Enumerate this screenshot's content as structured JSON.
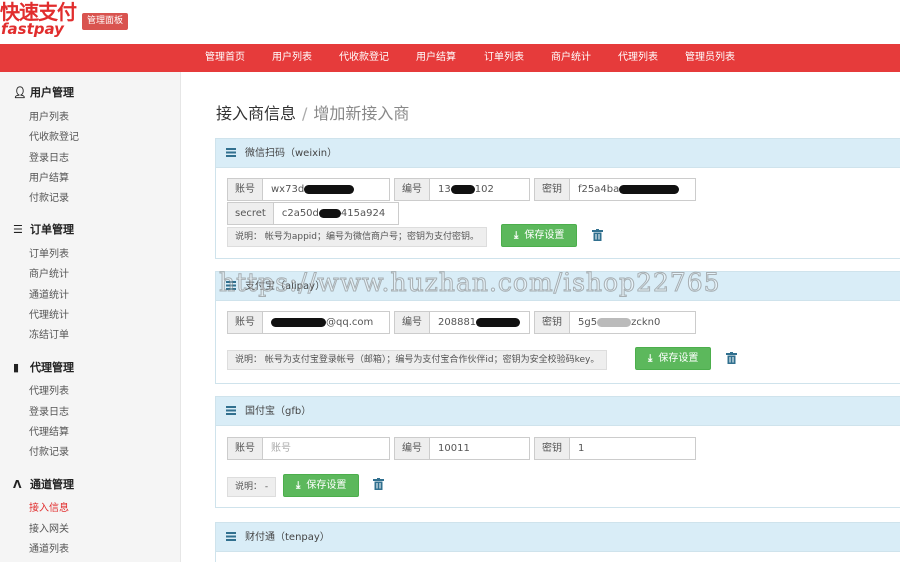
{
  "brand": {
    "name_cn": "快速支付",
    "name_en": "fastpay",
    "badge": "管理面板"
  },
  "topnav": [
    "管理首页",
    "用户列表",
    "代收款登记",
    "用户结算",
    "订单列表",
    "商户统计",
    "代理列表",
    "管理员列表"
  ],
  "sidebar": {
    "groups": [
      {
        "title": "用户管理",
        "icon": "user-icon",
        "items": [
          "用户列表",
          "代收款登记",
          "登录日志",
          "用户结算",
          "付款记录"
        ]
      },
      {
        "title": "订单管理",
        "icon": "list-icon",
        "items": [
          "订单列表",
          "商户统计",
          "通道统计",
          "代理统计",
          "冻结订单"
        ]
      },
      {
        "title": "代理管理",
        "icon": "file-icon",
        "items": [
          "代理列表",
          "登录日志",
          "代理结算",
          "付款记录"
        ]
      },
      {
        "title": "通道管理",
        "icon": "road-icon",
        "items": [
          "接入信息",
          "接入网关",
          "通道列表"
        ]
      }
    ],
    "active_item": "接入信息"
  },
  "breadcrumb": {
    "title": "接入商信息",
    "separator": "/",
    "subtitle": "增加新接入商"
  },
  "panels": {
    "weixin": {
      "title": "微信扫码（weixin）",
      "account_label": "账号",
      "account_value": "wx73d",
      "id_label": "编号",
      "id_value_a": "13",
      "id_value_b": "102",
      "key_label": "密钥",
      "key_value": "f25a4ba",
      "secret_label": "secret",
      "secret_value_a": "c2a50d",
      "secret_value_b": "415a924",
      "note": "说明：  帐号为appid；编号为微信商户号；密钥为支付密钥。",
      "save": "保存设置"
    },
    "alipay": {
      "title": "支付宝（alipay）",
      "account_label": "账号",
      "account_value": "@qq.com",
      "id_label": "编号",
      "id_value": "208881",
      "key_label": "密钥",
      "key_value": "5g5",
      "key_value_b": "zckn0",
      "note": "说明：  帐号为支付宝登录帐号（邮箱）；编号为支付宝合作伙伴id；密钥为安全校验码key。",
      "save": "保存设置"
    },
    "gfb": {
      "title": "国付宝（gfb）",
      "account_label": "账号",
      "account_placeholder": "账号",
      "id_label": "编号",
      "id_value": "10011",
      "key_label": "密钥",
      "key_value": "1",
      "note": "说明：  -",
      "save": "保存设置"
    },
    "tenpay": {
      "title": "财付通（tenpay）"
    }
  },
  "watermark": "https://www.huzhan.com/ishop22765"
}
